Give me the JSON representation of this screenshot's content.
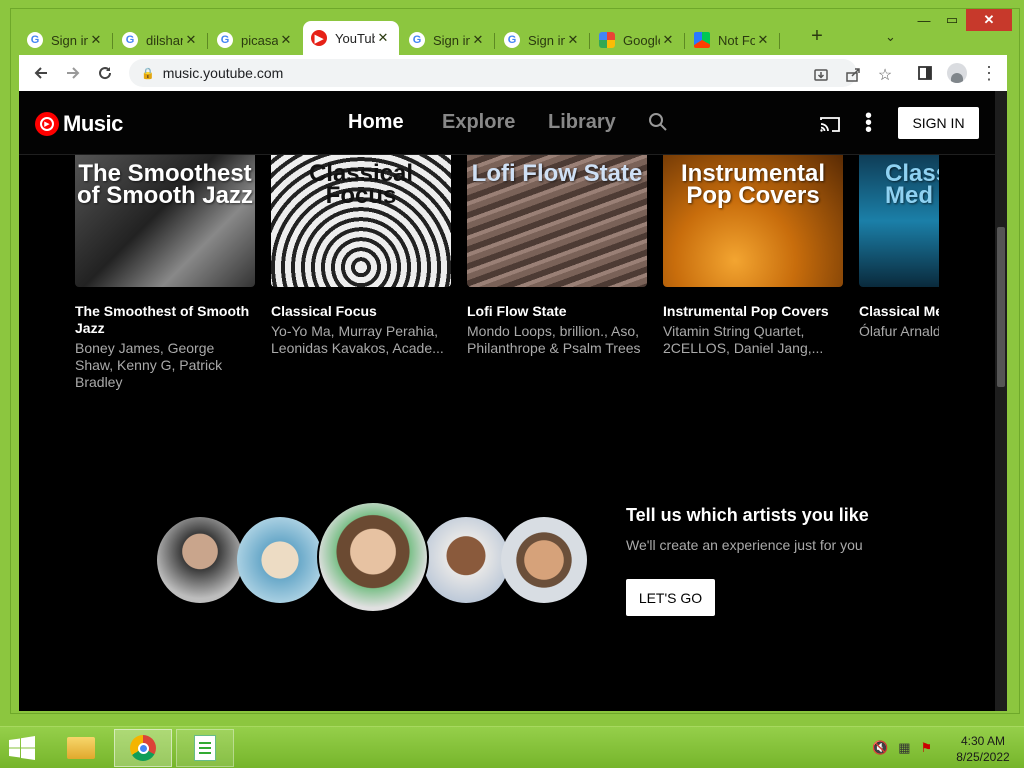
{
  "browser": {
    "tabs": [
      {
        "title": "Sign in",
        "favicon": "google-icon",
        "active": false
      },
      {
        "title": "dilshan",
        "favicon": "google-icon",
        "active": false
      },
      {
        "title": "picasa",
        "favicon": "google-icon",
        "active": false
      },
      {
        "title": "YouTube Music",
        "favicon": "youtube-music-icon",
        "active": true
      },
      {
        "title": "Sign in",
        "favicon": "google-icon",
        "active": false
      },
      {
        "title": "Sign in",
        "favicon": "google-icon",
        "active": false
      },
      {
        "title": "Google Photos",
        "favicon": "google-photos-icon",
        "active": false
      },
      {
        "title": "Not Found",
        "favicon": "google-play-icon",
        "active": false
      }
    ],
    "new_tab": "+",
    "url": "music.youtube.com"
  },
  "ytm": {
    "logo_text": "Music",
    "nav": {
      "home": "Home",
      "explore": "Explore",
      "library": "Library"
    },
    "sign_in": "SIGN IN",
    "cards": [
      {
        "thumb_text": "The Smoothest of Smooth Jazz",
        "title": "The Smoothest of Smooth Jazz",
        "subtitle": "Boney James, George Shaw, Kenny G, Patrick Bradley"
      },
      {
        "thumb_text": "Classical Focus",
        "title": "Classical Focus",
        "subtitle": "Yo-Yo Ma, Murray Perahia, Leonidas Kavakos, Acade..."
      },
      {
        "thumb_text": "Lofi Flow State",
        "title": "Lofi Flow State",
        "subtitle": "Mondo Loops, brillion., Aso, Philanthrope & Psalm Trees"
      },
      {
        "thumb_text": "Instrumental Pop Covers",
        "title": "Instrumental Pop Covers",
        "subtitle": "Vitamin String Quartet, 2CELLOS, Daniel Jang,..."
      },
      {
        "thumb_text": "Classical Med",
        "title": "Classical Me",
        "subtitle": "Ólafur Arnald Einaudi, Step"
      }
    ],
    "prompt": {
      "title": "Tell us which artists you like",
      "subtitle": "We'll create an experience just for you",
      "button": "LET'S GO"
    }
  },
  "taskbar": {
    "time": "4:30 AM",
    "date": "8/25/2022"
  }
}
